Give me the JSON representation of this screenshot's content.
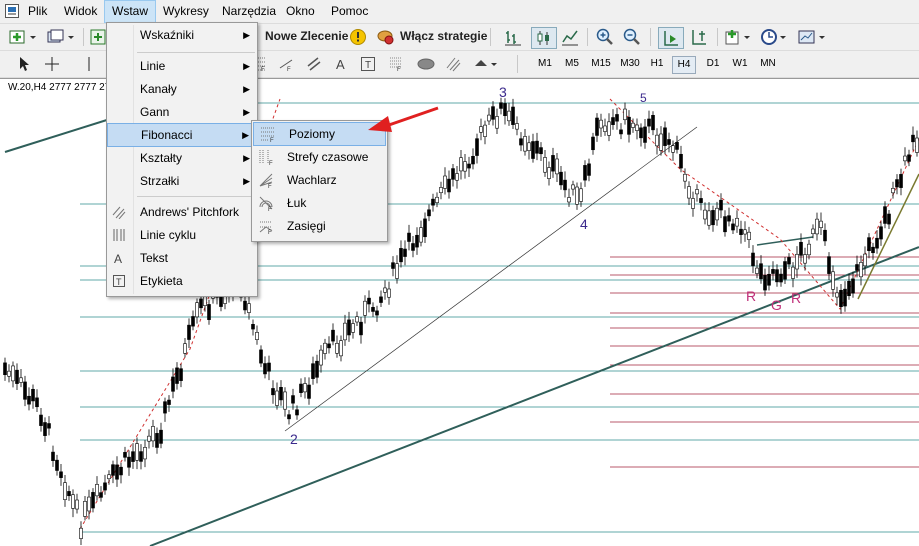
{
  "menubar": {
    "items": [
      {
        "label": "Plik"
      },
      {
        "label": "Widok"
      },
      {
        "label": "Wstaw"
      },
      {
        "label": "Wykresy"
      },
      {
        "label": "Narzędzia"
      },
      {
        "label": "Okno"
      },
      {
        "label": "Pomoc"
      }
    ],
    "active_index": 2
  },
  "toolbar": {
    "new_order_label": "Nowe Zlecenie",
    "strategies_label": "Włącz strategie",
    "timeframes": [
      "M1",
      "M5",
      "M15",
      "M30",
      "H1",
      "H4",
      "D1",
      "W1",
      "MN"
    ],
    "active_timeframe": "H4"
  },
  "chart": {
    "title": "W.20,H4  2777 2777 27",
    "wave_labels": {
      "w2": "2",
      "w3": "3",
      "w4": "4",
      "w5": "5",
      "r1": "R",
      "g": "G",
      "r2": "R"
    },
    "colors": {
      "candles": "#000000",
      "fib_lines": "#2e8b8b",
      "fib_red": "#a0203a",
      "trendline": "#2f5f5a",
      "label_purple": "#3b2a8c",
      "label_pink": "#c0307a"
    }
  },
  "insert_menu": {
    "items": [
      {
        "label": "Wskaźniki",
        "submenu": true
      },
      {
        "label": "Linie",
        "submenu": true
      },
      {
        "label": "Kanały",
        "submenu": true
      },
      {
        "label": "Gann",
        "submenu": true
      },
      {
        "label": "Fibonacci",
        "submenu": true
      },
      {
        "label": "Kształty",
        "submenu": true
      },
      {
        "label": "Strzałki",
        "submenu": true
      },
      {
        "label": "Andrews' Pitchfork",
        "submenu": false
      },
      {
        "label": "Linie cyklu",
        "submenu": false
      },
      {
        "label": "Tekst",
        "submenu": false
      },
      {
        "label": "Etykieta",
        "submenu": false
      }
    ],
    "highlighted": "Fibonacci"
  },
  "fibonacci_submenu": {
    "items": [
      {
        "label": "Poziomy"
      },
      {
        "label": "Strefy czasowe"
      },
      {
        "label": "Wachlarz"
      },
      {
        "label": "Łuk"
      },
      {
        "label": "Zasięgi"
      }
    ],
    "highlighted": "Poziomy"
  },
  "annotation": {
    "arrow_color": "#e02020"
  }
}
